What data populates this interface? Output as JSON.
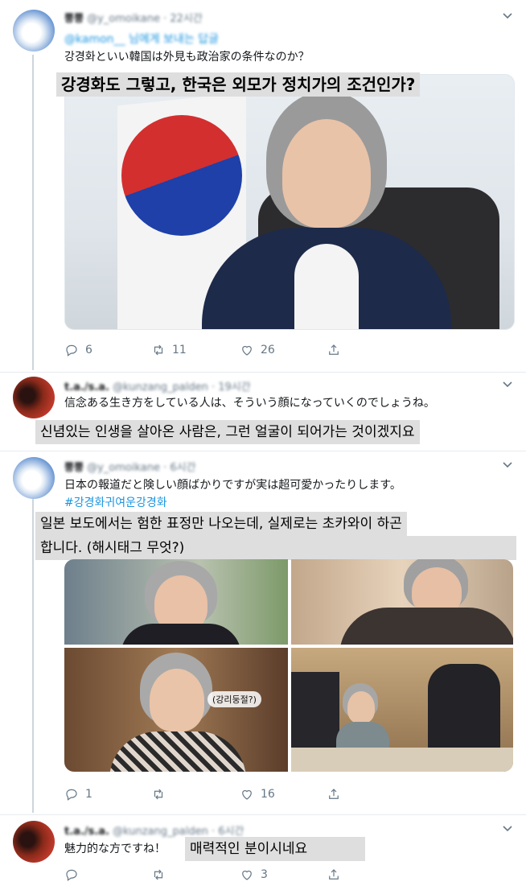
{
  "tweets": [
    {
      "display_name": "뿡뿡",
      "handle": "@y_omoikane",
      "time": "· 22시간",
      "reply_to": "@kamon__ 님에게 보내는 답글",
      "text": "강경화といい韓国は外見も政治家の条件なのか？",
      "caption": "강경화도 그렇고, 한국은 외모가 정치가의 조건인가?",
      "replies": "6",
      "retweets": "11",
      "likes": "26"
    },
    {
      "display_name": "t.a./s.a.",
      "handle": "@kunzang_palden",
      "time": "· 19시간",
      "text": "信念ある生き方をしている人は、そういう顔になっていくのでしょうね。",
      "caption": "신념있는 인생을 살아온 사람은, 그런 얼굴이 되어가는 것이겠지요"
    },
    {
      "display_name": "뿡뿡",
      "handle": "@y_omoikane",
      "time": "· 6시간",
      "text": "日本の報道だと険しい顔ばかりですが実は超可愛かったりします。",
      "hashtag": "#강경화귀여운강경화",
      "caption_line1": "일본 보도에서는 험한 표정만 나오는데, 실제로는 초카와이 하곤",
      "caption_line2": "합니다. (해시태그 무엇?)",
      "photo_label": "(강리둥절?)",
      "replies": "1",
      "retweets": "",
      "likes": "16"
    },
    {
      "display_name": "t.a./s.a.",
      "handle": "@kunzang_palden",
      "time": "· 6시간",
      "text": "魅力的な方ですね！",
      "caption": "매력적인 분이시네요",
      "replies": "",
      "retweets": "",
      "likes": "3"
    }
  ],
  "icons": {
    "reply": "reply-icon",
    "retweet": "retweet-icon",
    "like": "heart-icon",
    "share": "share-icon",
    "more": "chevron-down-icon"
  },
  "colors": {
    "link": "#1b95e0",
    "secondary_text": "#657786",
    "caption_bg": "#dedede",
    "thread_line": "#ccd6dd"
  }
}
